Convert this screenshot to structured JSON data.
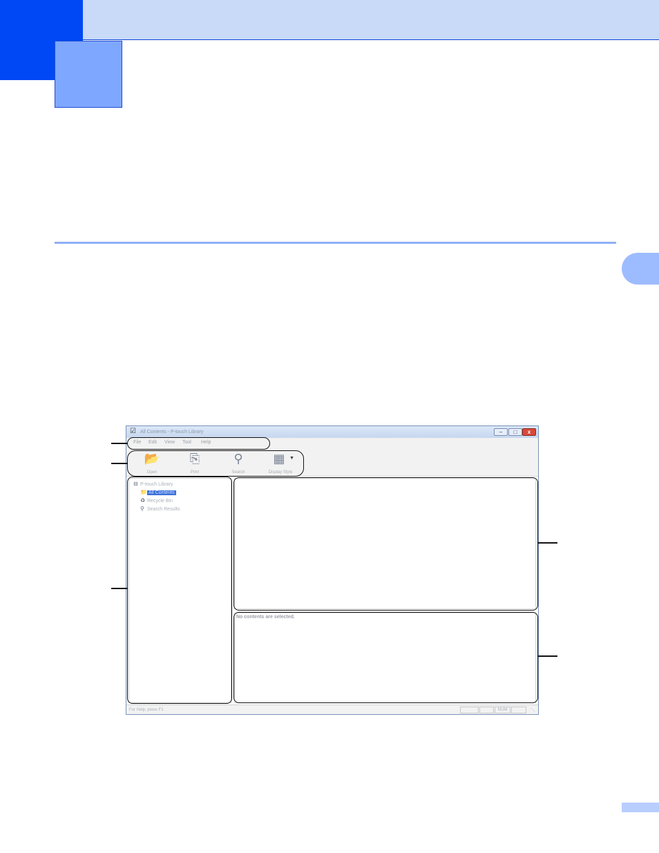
{
  "window": {
    "title": "All Contents - P-touch Library",
    "app_icon": "p-touch-library-icon",
    "controls": {
      "minimize": "–",
      "maximize": "□",
      "close": "x"
    }
  },
  "menu": [
    "File",
    "Edit",
    "View",
    "Tool",
    "Help"
  ],
  "toolbar": {
    "open": "Open",
    "print": "Print",
    "search": "Search",
    "display_style": "Display Style"
  },
  "tree": {
    "root": "P-touch Library",
    "items": [
      "All Contents",
      "Recycle Bin",
      "Search Results"
    ]
  },
  "preview": {
    "message": "No contents are selected."
  },
  "status": {
    "help": "For Help, press F1",
    "num": "NUM"
  },
  "colors": {
    "top_band": "#c9daf8",
    "corner_block": "#0048f5",
    "chapter_box": "#7ea7ff",
    "rule": "#8fb0f7",
    "selection": "#3a6fd8"
  }
}
